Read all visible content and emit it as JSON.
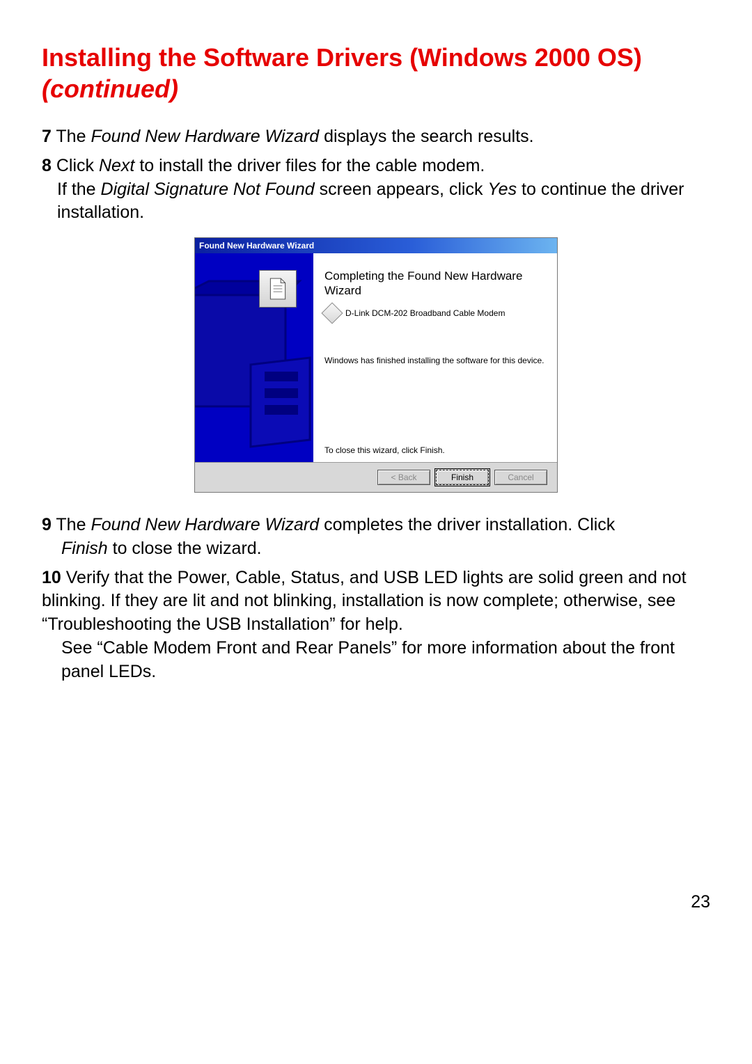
{
  "title_line1": "Installing the Software Drivers (Windows 2000 OS)",
  "title_line2": "(continued)",
  "steps": {
    "s7_num": "7",
    "s7_pre": " The ",
    "s7_em": "Found New Hardware Wizard",
    "s7_post": " displays the search results.",
    "s8_num": "8",
    "s8_a_pre": " Click ",
    "s8_a_em": "Next",
    "s8_a_post": " to install the driver files for the cable modem.",
    "s8_b_pre": "If the ",
    "s8_b_em": "Digital Signature Not Found",
    "s8_b_mid": " screen appears, click ",
    "s8_b_em2": "Yes",
    "s8_b_post": " to continue the driver installation.",
    "s9_num": "9",
    "s9_a_pre": "  The ",
    "s9_a_em": "Found New Hardware Wizard",
    "s9_a_post": " completes the driver installation. Click ",
    "s9_b_em": "Finish",
    "s9_b_post": " to close the wizard.",
    "s10_num": "10",
    "s10_text_a": " Verify that the Power, Cable, Status, and USB LED lights are solid green and not blinking. If they are lit and not blinking, installation is now complete; otherwise, see “Troubleshooting the USB Installation” for help.",
    "s10_text_b": "See “Cable Modem Front and Rear Panels” for more information about the front panel LEDs."
  },
  "wizard": {
    "titlebar": "Found New Hardware Wizard",
    "heading": "Completing the Found New Hardware Wizard",
    "device": "D-Link DCM-202 Broadband Cable Modem",
    "finished_msg": "Windows has finished installing the software for this device.",
    "close_hint": "To close this wizard, click Finish.",
    "btn_back": "< Back",
    "btn_finish": "Finish",
    "btn_cancel": "Cancel"
  },
  "page_number": "23"
}
